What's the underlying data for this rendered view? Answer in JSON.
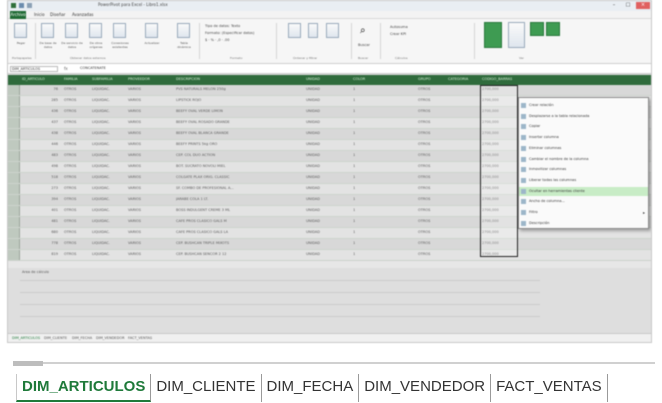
{
  "window": {
    "title": "PowerPivot para Excel - Libro1.xlsx",
    "file_label": "Archivo",
    "menu_tabs": [
      "Inicio",
      "Diseñar",
      "Avanzadas"
    ]
  },
  "formula_bar": {
    "name_box": "DIM_ARTICULOS",
    "fx": "fx",
    "value": "CONCATENATE"
  },
  "columns": [
    "ID_ARTICULO",
    "FAMILIA",
    "SUBFAMILIA",
    "PROVEEDOR",
    "DESCRIPCION",
    "UNIDAD",
    "COLOR",
    "GRUPO",
    "CATEGORIA",
    "CODIGO_BARRAS"
  ],
  "rows": [
    [
      "76",
      "OTROS",
      "LIQUIDAC.",
      "VARIOS",
      "PVS NATURALS MELON 250g",
      "UNIDAD",
      "1",
      "OTROS",
      "2700,000"
    ],
    [
      "285",
      "OTROS",
      "LIQUIDAC.",
      "VARIOS",
      "LIPSTICK ROJO",
      "UNIDAD",
      "1",
      "OTROS",
      "2700,000"
    ],
    [
      "436",
      "OTROS",
      "LIQUIDAC.",
      "VARIOS",
      "BEEFY OVAL VERDE LIMON",
      "UNIDAD",
      "1",
      "OTROS",
      "2700,000"
    ],
    [
      "437",
      "OTROS",
      "LIQUIDAC.",
      "VARIOS",
      "BEEFY OVAL ROSADO GRANDE",
      "UNIDAD",
      "1",
      "OTROS",
      "2700,000"
    ],
    [
      "438",
      "OTROS",
      "LIQUIDAC.",
      "VARIOS",
      "BEEFY OVAL BLANCA GRANDE",
      "UNIDAD",
      "1",
      "OTROS",
      "2700,000"
    ],
    [
      "446",
      "OTROS",
      "LIQUIDAC.",
      "VARIOS",
      "BEEFY PRINTS 5kg ORO",
      "UNIDAD",
      "1",
      "OTROS",
      "2700,000"
    ],
    [
      "483",
      "OTROS",
      "LIQUIDAC.",
      "VARIOS",
      "CEP. COL DUO ACTION",
      "UNIDAD",
      "1",
      "OTROS",
      "2700,000"
    ],
    [
      "498",
      "OTROS",
      "LIQUIDAC.",
      "VARIOS",
      "BOT. SUCRATO NOVOLI MIEL",
      "UNIDAD",
      "1",
      "OTROS",
      "2700,000"
    ],
    [
      "518",
      "OTROS",
      "LIQUIDAC.",
      "VARIOS",
      "COLGATE PLAX ORIG. CLASSIC",
      "UNIDAD",
      "1",
      "OTROS",
      "2700,000"
    ],
    [
      "273",
      "OTROS",
      "LIQUIDAC.",
      "VARIOS",
      "SF. COMBO DE PROFESIONAL A...",
      "UNIDAD",
      "1",
      "OTROS",
      "2700,000"
    ],
    [
      "394",
      "OTROS",
      "LIQUIDAC.",
      "VARIOS",
      "JARABE COLA 1 LT.",
      "UNIDAD",
      "1",
      "OTROS",
      "2700,000"
    ],
    [
      "401",
      "OTROS",
      "LIQUIDAC.",
      "VARIOS",
      "BOSS INDULGENT CREME 3 ML",
      "UNIDAD",
      "1",
      "OTROS",
      "2700,000"
    ],
    [
      "481",
      "OTROS",
      "LIQUIDAC.",
      "VARIOS",
      "CAFE PROS CLASICO GALS M",
      "UNIDAD",
      "1",
      "OTROS",
      "2700,000"
    ],
    [
      "680",
      "OTROS",
      "LIQUIDAC.",
      "VARIOS",
      "CAFE PROS CLASICO GALS LA",
      "UNIDAD",
      "1",
      "OTROS",
      "2700,000"
    ],
    [
      "778",
      "OTROS",
      "LIQUIDAC.",
      "VARIOS",
      "CEP. BUSHCAN TRIPLE MIXOTS",
      "UNIDAD",
      "1",
      "OTROS",
      "2700,000"
    ],
    [
      "819",
      "OTROS",
      "LIQUIDAC.",
      "VARIOS",
      "CEP. BUSHCAN SENCOR 2 12",
      "UNIDAD",
      "1",
      "OTROS",
      "2700,000"
    ]
  ],
  "context_menu": [
    {
      "label": "Crear relación",
      "highlight": false
    },
    {
      "label": "Desplazarse a la tabla relacionada",
      "highlight": false
    },
    {
      "label": "Copiar",
      "highlight": false
    },
    {
      "label": "Insertar columna",
      "highlight": false
    },
    {
      "label": "Eliminar columnas",
      "highlight": false
    },
    {
      "label": "Cambiar el nombre de la columna",
      "highlight": false
    },
    {
      "label": "Inmovilizar columnas",
      "highlight": false
    },
    {
      "label": "Liberar todas las columnas",
      "highlight": false
    },
    {
      "label": "Ocultar en herramientas cliente",
      "highlight": true
    },
    {
      "label": "Ancho de columna...",
      "highlight": false
    },
    {
      "label": "Filtro",
      "highlight": false
    },
    {
      "label": "Descripción",
      "highlight": false
    }
  ],
  "calc_area_label": "Area de cálculo",
  "mini_tabs": [
    "DIM_ARTICULOS",
    "DIM_CLIENTE",
    "DIM_FECHA",
    "DIM_VENDEDOR",
    "FACT_VENTAS"
  ],
  "sheet_tabs": [
    "DIM_ARTICULOS",
    "DIM_CLIENTE",
    "DIM_FECHA",
    "DIM_VENDEDOR",
    "FACT_VENTAS"
  ],
  "ribbon": {
    "buttons": [
      "Pegar",
      "De base de datos",
      "De servicio de datos",
      "De otros orígenes",
      "Conexiones existentes",
      "Actualizar",
      "Tabla dinámica"
    ],
    "format_text": [
      "Tipo de datos: Texto",
      "Formato: (Especificar datos)"
    ],
    "group_labels": [
      "Portapapeles",
      "Obtener datos externos",
      "Formato",
      "Ordenar y filtrar",
      "Buscar",
      "Cálculos",
      "Ver"
    ],
    "right_text": [
      "Autosuma",
      "Crear KPI"
    ],
    "find_label": "Buscar"
  }
}
